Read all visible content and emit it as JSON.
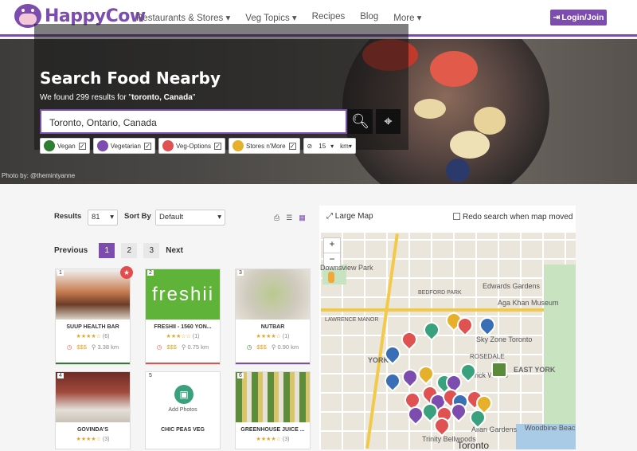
{
  "nav": {
    "logo": "HappyCow",
    "menu": [
      "Restaurants & Stores ▾",
      "Veg Topics ▾",
      "Recipes",
      "Blog",
      "More ▾"
    ],
    "login": "Login/Join"
  },
  "hero": {
    "title": "Search Food Nearby",
    "subtitle_prefix": "We found 299 results for \"",
    "subtitle_query": "toronto, Canada",
    "subtitle_suffix": "\"",
    "search_value": "Toronto, Ontario, Canada",
    "credit": "Photo by: @themintyanne",
    "filters": [
      {
        "label": "Vegan",
        "color": "#2e7d32"
      },
      {
        "label": "Vegetarian",
        "color": "#7c4dae"
      },
      {
        "label": "Veg-Options",
        "color": "#e05252"
      },
      {
        "label": "Stores n'More",
        "color": "#e6b02a"
      }
    ],
    "distance": "15",
    "distance_unit": "km"
  },
  "controls": {
    "results_label": "Results",
    "results_value": "81",
    "sort_label": "Sort By",
    "sort_value": "Default"
  },
  "pager": {
    "previous": "Previous",
    "pages": [
      "1",
      "2",
      "3"
    ],
    "next": "Next"
  },
  "cards": [
    {
      "num": "1",
      "name": "SÜÜP HEALTH BAR",
      "stars": "★★★★☆",
      "count": "(6)",
      "price": "$$$",
      "dist": "3.38 km",
      "bar": "#2e7d32"
    },
    {
      "num": "2",
      "name": "FRESHII - 1560 YON...",
      "stars": "★★★☆☆",
      "count": "(1)",
      "price": "$$$",
      "dist": "0.75 km",
      "bar": "#e05252"
    },
    {
      "num": "3",
      "name": "NUTBAR",
      "stars": "★★★★☆",
      "count": "(1)",
      "price": "$$$",
      "dist": "0.90 km",
      "bar": "#7c4dae"
    },
    {
      "num": "4",
      "name": "GOVINDA'S",
      "stars": "★★★★☆",
      "count": "(3)"
    },
    {
      "num": "5",
      "name": "CHIC PEAS VEG",
      "add": "Add Photos"
    },
    {
      "num": "6",
      "name": "GREENHOUSE JUICE ...",
      "stars": "★★★★☆",
      "count": "(3)"
    }
  ],
  "map": {
    "large": "Large Map",
    "redo": "Redo search when map moved",
    "labels": [
      "Downsview Park",
      "YORK",
      "EAST YORK",
      "Toronto",
      "Sky Zone Toronto",
      "Edwards Gardens",
      "Aga Khan Museum",
      "Woodbine Beac",
      "Trinity Bellwoods",
      "Allan Gardens",
      "Brick Works",
      "ROSEDALE",
      "BEDFORD PARK",
      "LAWRENCE MANOR"
    ]
  }
}
